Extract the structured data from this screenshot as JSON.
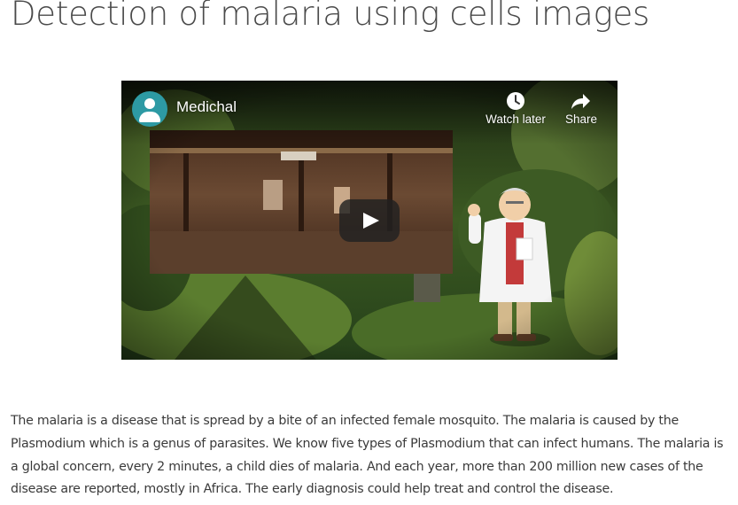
{
  "page": {
    "title": "Detection of malaria using cells images",
    "description": "The malaria is a disease that is spread by a bite of an infected female mosquito. The malaria is caused by the Plasmodium which is a genus of parasites. We know five types of Plasmodium that can infect humans. The malaria is a global concern, every 2 minutes, a child dies of malaria. And each year, more than 200 million new cases of the disease are reported, mostly in Africa. The early diagnosis could help treat and control the disease."
  },
  "video": {
    "channel_title": "Medichal",
    "watch_later_label": "Watch later",
    "share_label": "Share",
    "avatar_icon": "person-avatar-icon",
    "play_icon": "play-icon",
    "colors": {
      "avatar_bg": "#2d9aa4",
      "play_bg": "#212121"
    }
  }
}
